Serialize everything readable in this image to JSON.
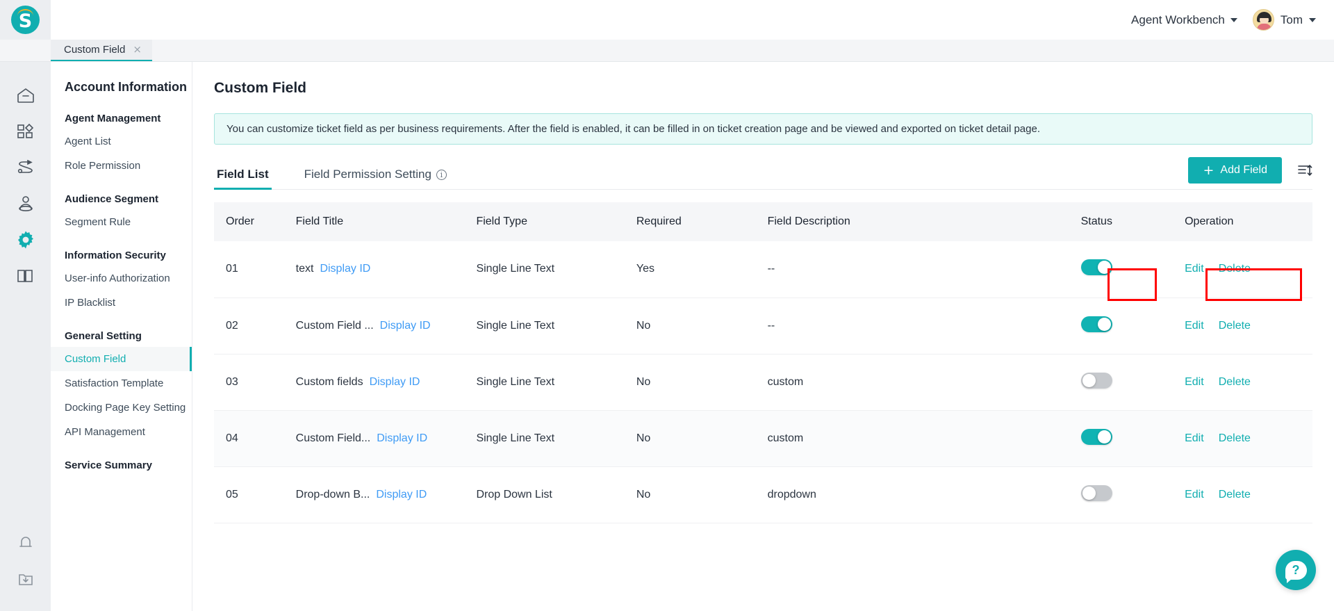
{
  "header": {
    "logo_letter": "S",
    "workbench_label": "Agent Workbench",
    "username": "Tom"
  },
  "tabstrip": {
    "tabs": [
      {
        "label": "Custom Field",
        "close": "×"
      }
    ]
  },
  "rail": {
    "items": [
      {
        "icon": "home-icon",
        "active": false
      },
      {
        "icon": "apps-icon",
        "active": false
      },
      {
        "icon": "workflow-icon",
        "active": false
      },
      {
        "icon": "audience-icon",
        "active": false
      },
      {
        "icon": "gear-icon",
        "active": true
      },
      {
        "icon": "book-icon",
        "active": false
      }
    ],
    "bottom": [
      {
        "icon": "bell-icon"
      },
      {
        "icon": "download-folder-icon"
      }
    ]
  },
  "sidebar": {
    "title": "Account Information",
    "groups": [
      {
        "label": "Agent Management",
        "items": [
          {
            "label": "Agent List",
            "active": false
          },
          {
            "label": "Role Permission",
            "active": false
          }
        ]
      },
      {
        "label": "Audience Segment",
        "items": [
          {
            "label": "Segment Rule",
            "active": false
          }
        ]
      },
      {
        "label": "Information Security",
        "items": [
          {
            "label": "User-info Authorization",
            "active": false
          },
          {
            "label": "IP Blacklist",
            "active": false
          }
        ]
      },
      {
        "label": "General Setting",
        "items": [
          {
            "label": "Custom Field",
            "active": true
          },
          {
            "label": "Satisfaction Template",
            "active": false
          },
          {
            "label": "Docking Page Key Setting",
            "active": false
          },
          {
            "label": "API Management",
            "active": false
          }
        ]
      },
      {
        "label": "Service Summary",
        "items": []
      }
    ]
  },
  "main": {
    "page_title": "Custom Field",
    "notice": "You can customize ticket field as per business requirements. After the field is enabled, it can be filled in on ticket creation page and be viewed and exported on ticket detail page.",
    "tabs": [
      {
        "label": "Field List",
        "active": true,
        "info_icon": false
      },
      {
        "label": "Field Permission Setting",
        "active": false,
        "info_icon": true
      }
    ],
    "info_glyph": "i",
    "add_button": {
      "plus": "+",
      "label": "Add Field"
    },
    "sort_icon": "sort-order-icon",
    "table": {
      "columns": [
        "Order",
        "Field Title",
        "Field Type",
        "Required",
        "Field Description",
        "Status",
        "Operation"
      ],
      "rows": [
        {
          "order": "01",
          "title": "text",
          "display_id": "Display ID",
          "type": "Single Line Text",
          "required": "Yes",
          "description": "--",
          "status_on": true,
          "edit": "Edit",
          "delete": "Delete",
          "hover": false
        },
        {
          "order": "02",
          "title": "Custom Field ...",
          "display_id": "Display ID",
          "type": "Single Line Text",
          "required": "No",
          "description": "--",
          "status_on": true,
          "edit": "Edit",
          "delete": "Delete",
          "hover": false
        },
        {
          "order": "03",
          "title": "Custom fields",
          "display_id": "Display ID",
          "type": "Single Line Text",
          "required": "No",
          "description": "custom",
          "status_on": false,
          "edit": "Edit",
          "delete": "Delete",
          "hover": false
        },
        {
          "order": "04",
          "title": "Custom Field...",
          "display_id": "Display ID",
          "type": "Single Line Text",
          "required": "No",
          "description": "custom",
          "status_on": true,
          "edit": "Edit",
          "delete": "Delete",
          "hover": true
        },
        {
          "order": "05",
          "title": "Drop-down B...",
          "display_id": "Display ID",
          "type": "Drop Down List",
          "required": "No",
          "description": "dropdown",
          "status_on": false,
          "edit": "Edit",
          "delete": "Delete",
          "hover": false
        }
      ]
    }
  },
  "help": {
    "glyph": "?"
  },
  "annotations": {
    "boxes": [
      {
        "name": "status-toggle-highlight",
        "color": "#ff0000"
      },
      {
        "name": "operation-links-highlight",
        "color": "#ff0000"
      }
    ]
  },
  "colors": {
    "accent": "#11aeb0",
    "link": "#3f9bf5",
    "notice_bg": "#e9faf8",
    "annotation": "#ff0000"
  }
}
